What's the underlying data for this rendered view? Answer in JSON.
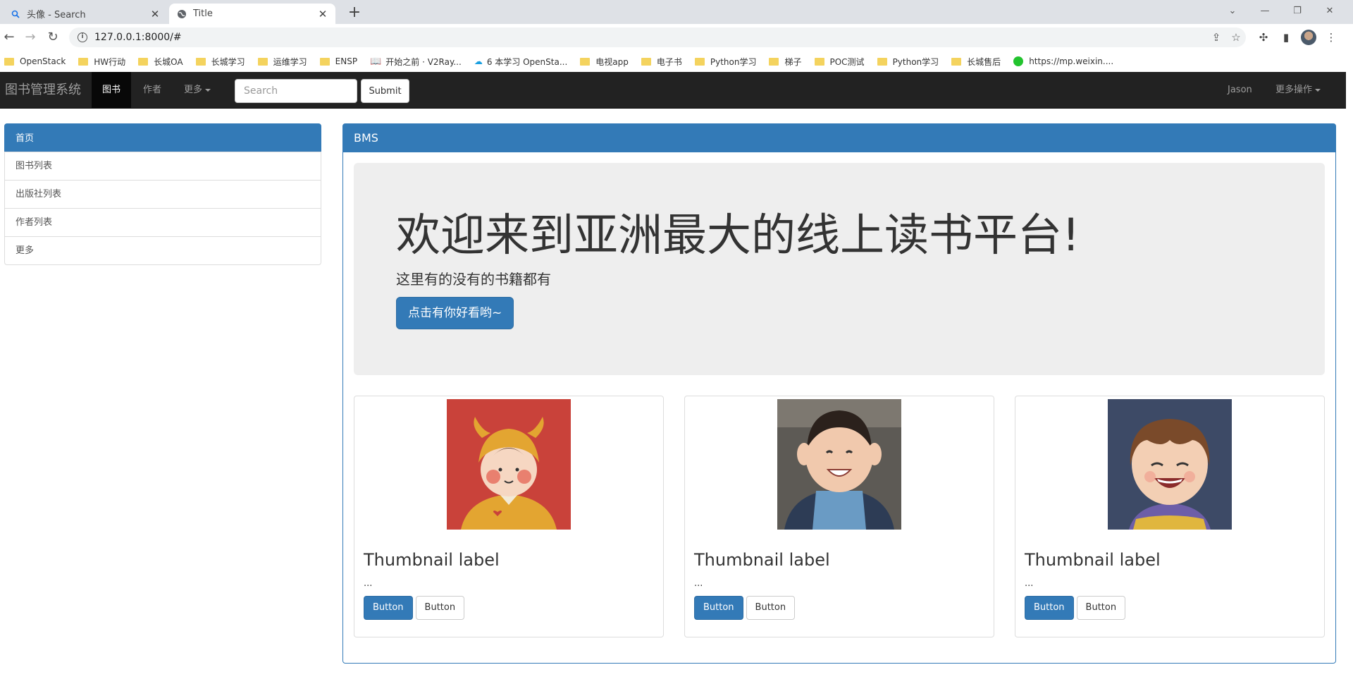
{
  "browser": {
    "tabs": [
      {
        "title": "头像 - Search",
        "icon": "search-icon"
      },
      {
        "title": "Title",
        "icon": "globe-icon"
      }
    ],
    "url": "127.0.0.1:8000/#",
    "bookmarks": [
      {
        "label": "OpenStack",
        "icon": "folder-icon"
      },
      {
        "label": "HW行动",
        "icon": "folder-icon"
      },
      {
        "label": "长城OA",
        "icon": "folder-icon"
      },
      {
        "label": "长城学习",
        "icon": "folder-icon"
      },
      {
        "label": "运维学习",
        "icon": "folder-icon"
      },
      {
        "label": "ENSP",
        "icon": "folder-icon"
      },
      {
        "label": "开始之前 · V2Ray...",
        "icon": "book-icon"
      },
      {
        "label": "6 本学习 OpenSta...",
        "icon": "cloud-icon"
      },
      {
        "label": "电视app",
        "icon": "folder-icon"
      },
      {
        "label": "电子书",
        "icon": "folder-icon"
      },
      {
        "label": "Python学习",
        "icon": "folder-icon"
      },
      {
        "label": "梯子",
        "icon": "folder-icon"
      },
      {
        "label": "POC测试",
        "icon": "folder-icon"
      },
      {
        "label": "Python学习",
        "icon": "folder-icon"
      },
      {
        "label": "长城售后",
        "icon": "folder-icon"
      },
      {
        "label": "https://mp.weixin....",
        "icon": "wechat-icon"
      }
    ]
  },
  "navbar": {
    "brand": "图书管理系统",
    "items": [
      {
        "label": "图书",
        "active": true
      },
      {
        "label": "作者",
        "active": false
      },
      {
        "label": "更多",
        "active": false,
        "dropdown": true
      }
    ],
    "search_placeholder": "Search",
    "submit_label": "Submit",
    "user": "Jason",
    "more_actions": "更多操作"
  },
  "sidebar": {
    "items": [
      {
        "label": "首页",
        "active": true
      },
      {
        "label": "图书列表"
      },
      {
        "label": "出版社列表"
      },
      {
        "label": "作者列表"
      },
      {
        "label": "更多"
      }
    ]
  },
  "panel": {
    "heading": "BMS",
    "jumbotron": {
      "title": "欢迎来到亚洲最大的线上读书平台!",
      "subtitle": "这里有的没有的书籍都有",
      "button": "点击有你好看哟~"
    },
    "thumbnails": [
      {
        "label": "Thumbnail label",
        "text": "...",
        "primary": "Button",
        "secondary": "Button",
        "image": "cartoon-ox-avatar"
      },
      {
        "label": "Thumbnail label",
        "text": "...",
        "primary": "Button",
        "secondary": "Button",
        "image": "child-photo-avatar"
      },
      {
        "label": "Thumbnail label",
        "text": "...",
        "primary": "Button",
        "secondary": "Button",
        "image": "cartoon-girl-avatar"
      }
    ]
  },
  "colors": {
    "primary": "#337ab7",
    "navbar_bg": "#222222",
    "jumbotron_bg": "#eeeeee"
  }
}
